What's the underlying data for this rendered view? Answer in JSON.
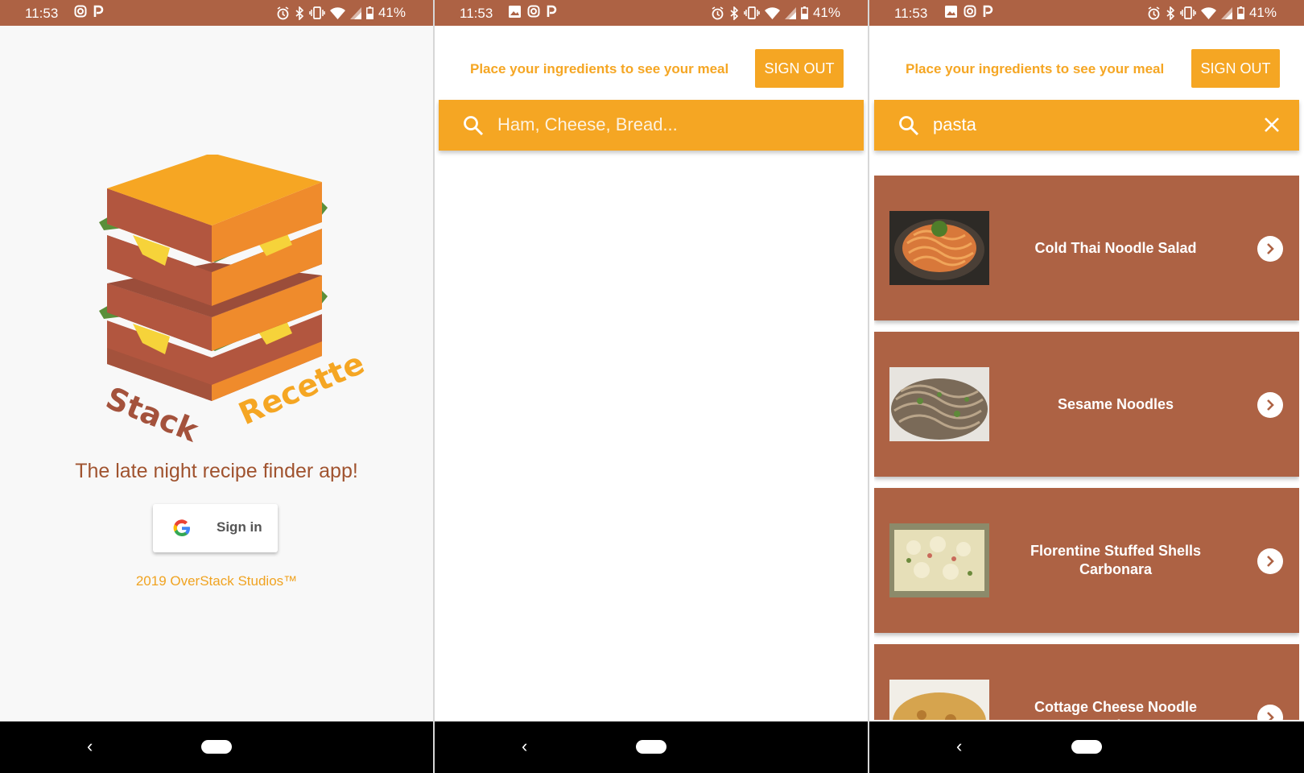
{
  "status_bar": {
    "time": "11:53",
    "battery": "41%"
  },
  "login": {
    "logo_word_1": "Stack",
    "logo_word_2": "Recette",
    "tagline": "The late night recipe finder app!",
    "signin_label": "Sign in",
    "copyright": "2019 OverStack Studios™"
  },
  "search_empty": {
    "hint": "Place your ingredients to see your meal",
    "signout_label": "SIGN OUT",
    "search_placeholder": "Ham, Cheese, Bread..."
  },
  "search_results": {
    "hint": "Place your ingredients to see your meal",
    "signout_label": "SIGN OUT",
    "search_value": "pasta",
    "results": [
      {
        "title": "Cold Thai Noodle Salad"
      },
      {
        "title": "Sesame Noodles"
      },
      {
        "title": "Florentine Stuffed Shells Carbonara"
      },
      {
        "title": "Cottage Cheese Noodle Bake"
      }
    ]
  },
  "colors": {
    "brand_brown": "#ad6244",
    "accent_orange": "#f5a623",
    "tagline_brown": "#a0532f"
  },
  "icons": [
    "instagram-icon",
    "p-icon",
    "image-icon",
    "alarm-icon",
    "bluetooth-icon",
    "vibrate-icon",
    "wifi-icon",
    "signal-icon",
    "battery-icon",
    "google-g-icon",
    "search-icon",
    "close-icon",
    "chevron-right-icon",
    "back-icon",
    "home-pill-icon"
  ]
}
